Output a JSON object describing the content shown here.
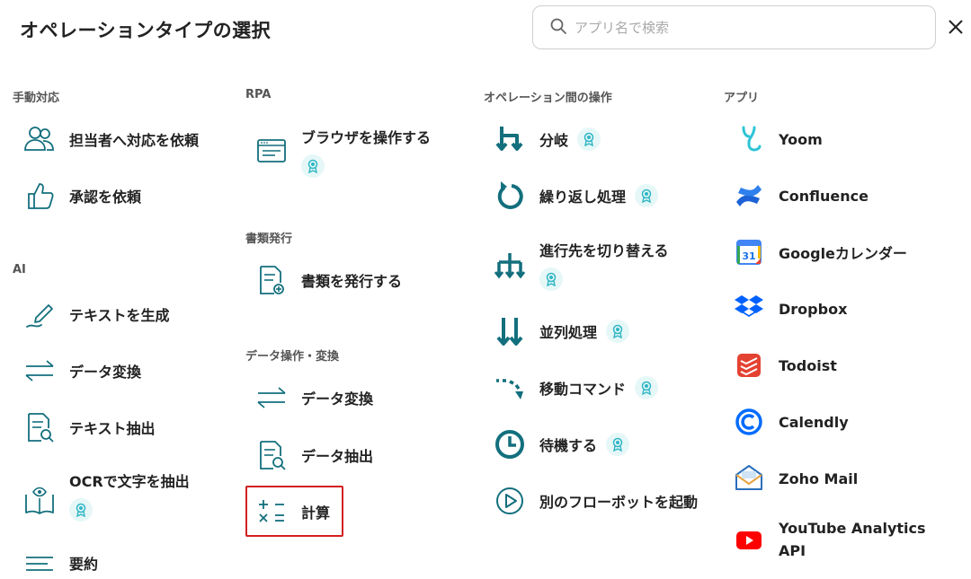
{
  "dialog": {
    "title": "オペレーションタイプの選択"
  },
  "search": {
    "placeholder": "アプリ名で検索",
    "value": ""
  },
  "columns": {
    "manual": {
      "heading": "手動対応",
      "items": [
        "担当者へ対応を依頼",
        "承認を依頼"
      ]
    },
    "ai": {
      "heading": "AI",
      "items": [
        "テキストを生成",
        "データ変換",
        "テキスト抽出",
        "OCRで文字を抽出",
        "要約"
      ]
    },
    "rpa": {
      "heading": "RPA",
      "items": [
        "ブラウザを操作する"
      ]
    },
    "docs": {
      "heading": "書類発行",
      "items": [
        "書類を発行する"
      ]
    },
    "data": {
      "heading": "データ操作・変換",
      "items": [
        "データ変換",
        "データ抽出",
        "計算"
      ]
    },
    "ops": {
      "heading": "オペレーション間の操作",
      "items": [
        "分岐",
        "繰り返し処理",
        "進行先を切り替える",
        "並列処理",
        "移動コマンド",
        "待機する",
        "別のフローボットを起動"
      ]
    },
    "apps": {
      "heading": "アプリ",
      "items": [
        "Yoom",
        "Confluence",
        "Googleカレンダー",
        "Dropbox",
        "Todoist",
        "Calendly",
        "Zoho Mail",
        "YouTube Analytics",
        "API"
      ]
    }
  },
  "selected_item": "計算",
  "colors": {
    "teal": "#136f7d",
    "accent": "#2fb6c4",
    "badge_bg": "#e6f7f8",
    "selection": "#d32020"
  }
}
